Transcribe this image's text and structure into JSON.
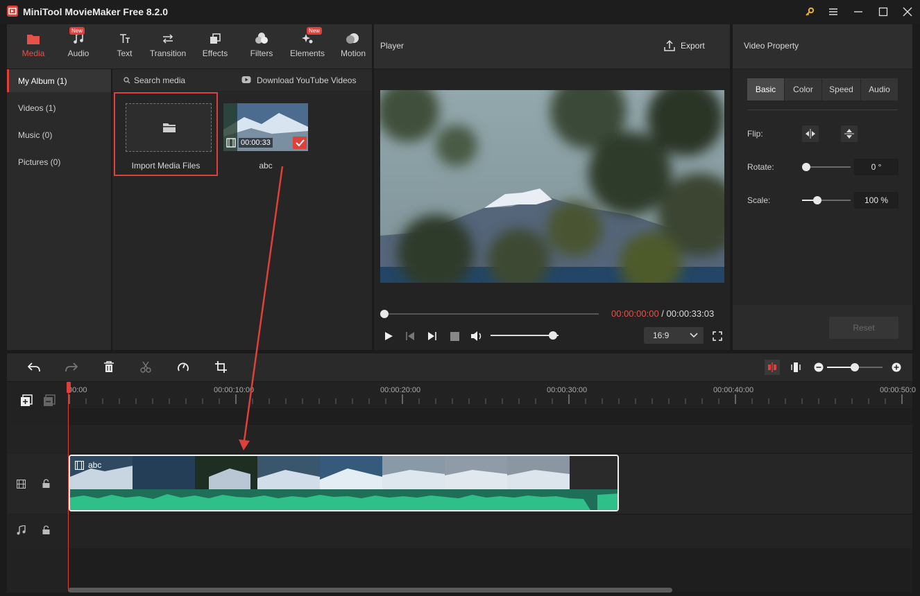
{
  "app": {
    "title": "MiniTool MovieMaker Free 8.2.0"
  },
  "toolbar": {
    "tabs": [
      {
        "label": "Media",
        "icon": "folder-icon",
        "active": true
      },
      {
        "label": "Audio",
        "icon": "music-note-icon",
        "badge": "New"
      },
      {
        "label": "Text",
        "icon": "text-icon"
      },
      {
        "label": "Transition",
        "icon": "swap-arrows-icon"
      },
      {
        "label": "Effects",
        "icon": "layers-icon"
      },
      {
        "label": "Filters",
        "icon": "filters-icon"
      },
      {
        "label": "Elements",
        "icon": "sparkle-icon",
        "badge": "New"
      },
      {
        "label": "Motion",
        "icon": "motion-icon"
      }
    ]
  },
  "library": {
    "nav": [
      {
        "label": "My Album (1)",
        "active": true
      },
      {
        "label": "Videos (1)"
      },
      {
        "label": "Music (0)"
      },
      {
        "label": "Pictures (0)"
      }
    ],
    "search_placeholder": "Search media",
    "download_label": "Download YouTube Videos",
    "import_label": "Import Media Files",
    "clip": {
      "name": "abc",
      "duration": "00:00:33"
    }
  },
  "player": {
    "title": "Player",
    "export_label": "Export",
    "current_time": "00:00:00:00",
    "separator": " / ",
    "total_time": "00:00:33:03",
    "aspect": "16:9",
    "volume_level": 0.92,
    "progress": 0.0
  },
  "properties": {
    "title": "Video Property",
    "tabs": [
      "Basic",
      "Color",
      "Speed",
      "Audio"
    ],
    "active_tab": "Basic",
    "flip_label": "Flip:",
    "rotate_label": "Rotate:",
    "rotate_value": "0 °",
    "scale_label": "Scale:",
    "scale_value": "100 %",
    "reset_label": "Reset"
  },
  "timeline": {
    "ruler_labels": [
      "00:00",
      "00:00:10:00",
      "00:00:20:00",
      "00:00:30:00",
      "00:00:40:00",
      "00:00:50:0"
    ],
    "clip_label": "abc",
    "zoom_level": 0.5
  },
  "colors": {
    "accent": "#e0403a",
    "waveform": "#2fbf88",
    "panel": "#2e2e2e"
  }
}
